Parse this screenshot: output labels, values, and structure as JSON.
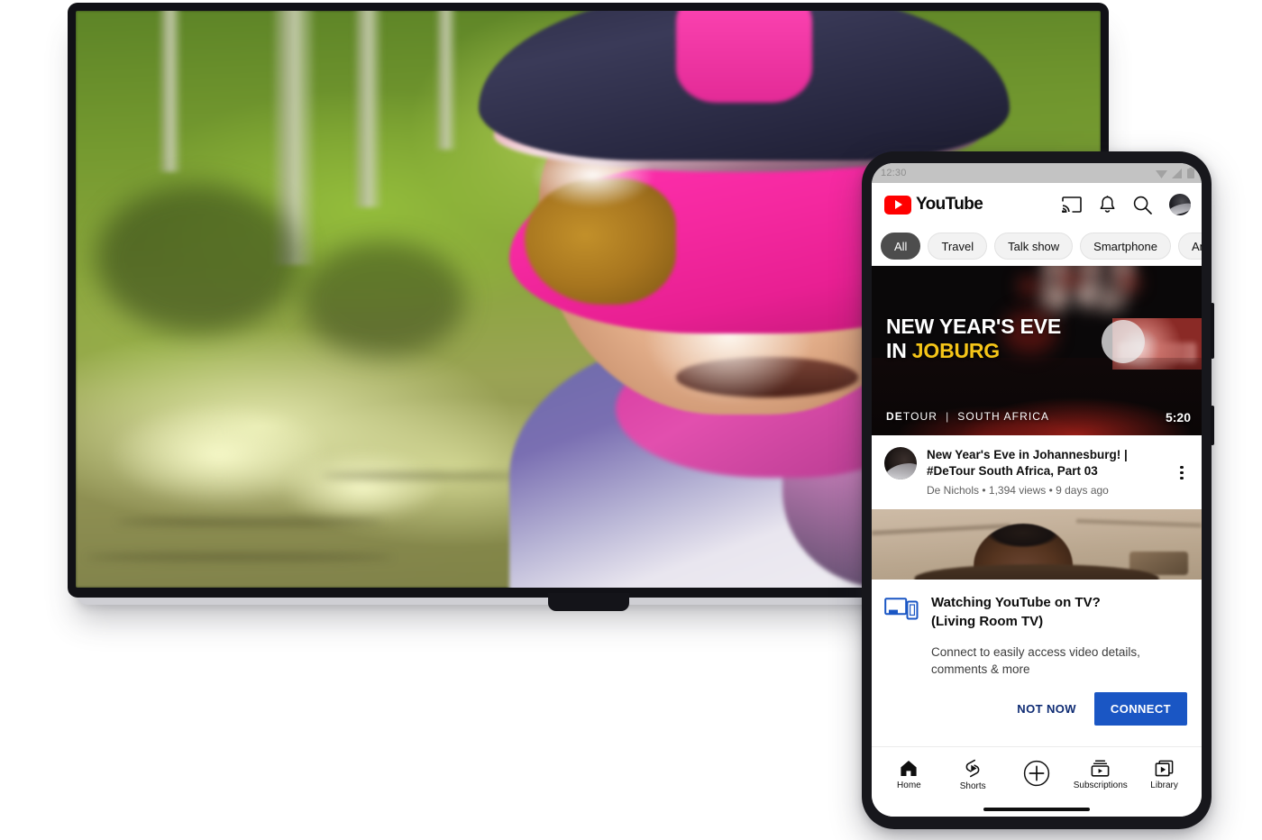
{
  "scene": {
    "background_color": "#ffffff",
    "devices": [
      "living-room-tv",
      "android-phone"
    ]
  },
  "tv": {
    "label": "Living Room TV",
    "bezel_color": "#111116",
    "video": {
      "description": "Point-of-view cycling video: a cyclist wearing a dark helmet with pink accents, a pink-tinted visor and bright magenta wraparound sunglasses, in a purple and white jersey with a magenta neck gaiter, riding through a sunlit green forest trail.",
      "dominant_colors": [
        "#7a9a33",
        "#ff2fae",
        "#6a6aa8",
        "#f0c5a4"
      ]
    }
  },
  "phone": {
    "frame_color": "#17171c",
    "status_bar": {
      "time": "12:30",
      "background_color": "#c3c3c3",
      "icons": [
        "wifi-icon",
        "cell-signal-icon",
        "battery-icon"
      ]
    },
    "header": {
      "brand": "YouTube",
      "brand_color": "#ff0000",
      "actions": [
        "cast-icon",
        "notifications-bell-icon",
        "search-icon",
        "account-avatar"
      ]
    },
    "chips": [
      {
        "label": "All",
        "selected": true
      },
      {
        "label": "Travel",
        "selected": false
      },
      {
        "label": "Talk show",
        "selected": false
      },
      {
        "label": "Smartphone",
        "selected": false
      },
      {
        "label": "An",
        "selected": false
      }
    ],
    "feed": {
      "video": {
        "thumbnail": {
          "title_line_1": "NEW YEAR'S EVE",
          "title_line_2_prefix": "IN ",
          "title_line_2_accent": "JOBURG",
          "accent_color": "#f5c518",
          "brand_strong": "DE",
          "brand_rest": "TOUR",
          "brand_separator": "|",
          "brand_region": "SOUTH AFRICA",
          "duration": "5:20",
          "scene_description": "Concert stage lit with red lights, spotlights overhead, crowd silhouettes and a side video screen."
        },
        "title": "New Year's Eve in Johannesburg! | #DeTour South Africa, Part 03",
        "channel": "De Nichols",
        "views": "1,394 views",
        "age": "9 days ago",
        "stats": "De Nichols • 1,394 views • 9 days ago",
        "menu_icon": "overflow-menu-icon"
      },
      "next_video": {
        "thumbnail_description": "Partially visible thumbnail of a person indoors in a room with light-colored walls."
      }
    },
    "connect_dialog": {
      "icon": "tv-and-phone-icon",
      "icon_color": "#1a56c4",
      "heading_line_1": "Watching YouTube on TV?",
      "heading_line_2": "(Living Room TV)",
      "body": "Connect to easily access video details, comments & more",
      "secondary_button": "NOT NOW",
      "secondary_button_color": "#0e2b73",
      "primary_button": "CONNECT",
      "primary_button_color": "#1a56c4"
    },
    "bottom_nav": [
      {
        "label": "Home",
        "icon": "home-icon"
      },
      {
        "label": "Shorts",
        "icon": "shorts-icon"
      },
      {
        "label": "",
        "icon": "create-plus-icon"
      },
      {
        "label": "Subscriptions",
        "icon": "subscriptions-icon"
      },
      {
        "label": "Library",
        "icon": "library-icon"
      }
    ]
  }
}
